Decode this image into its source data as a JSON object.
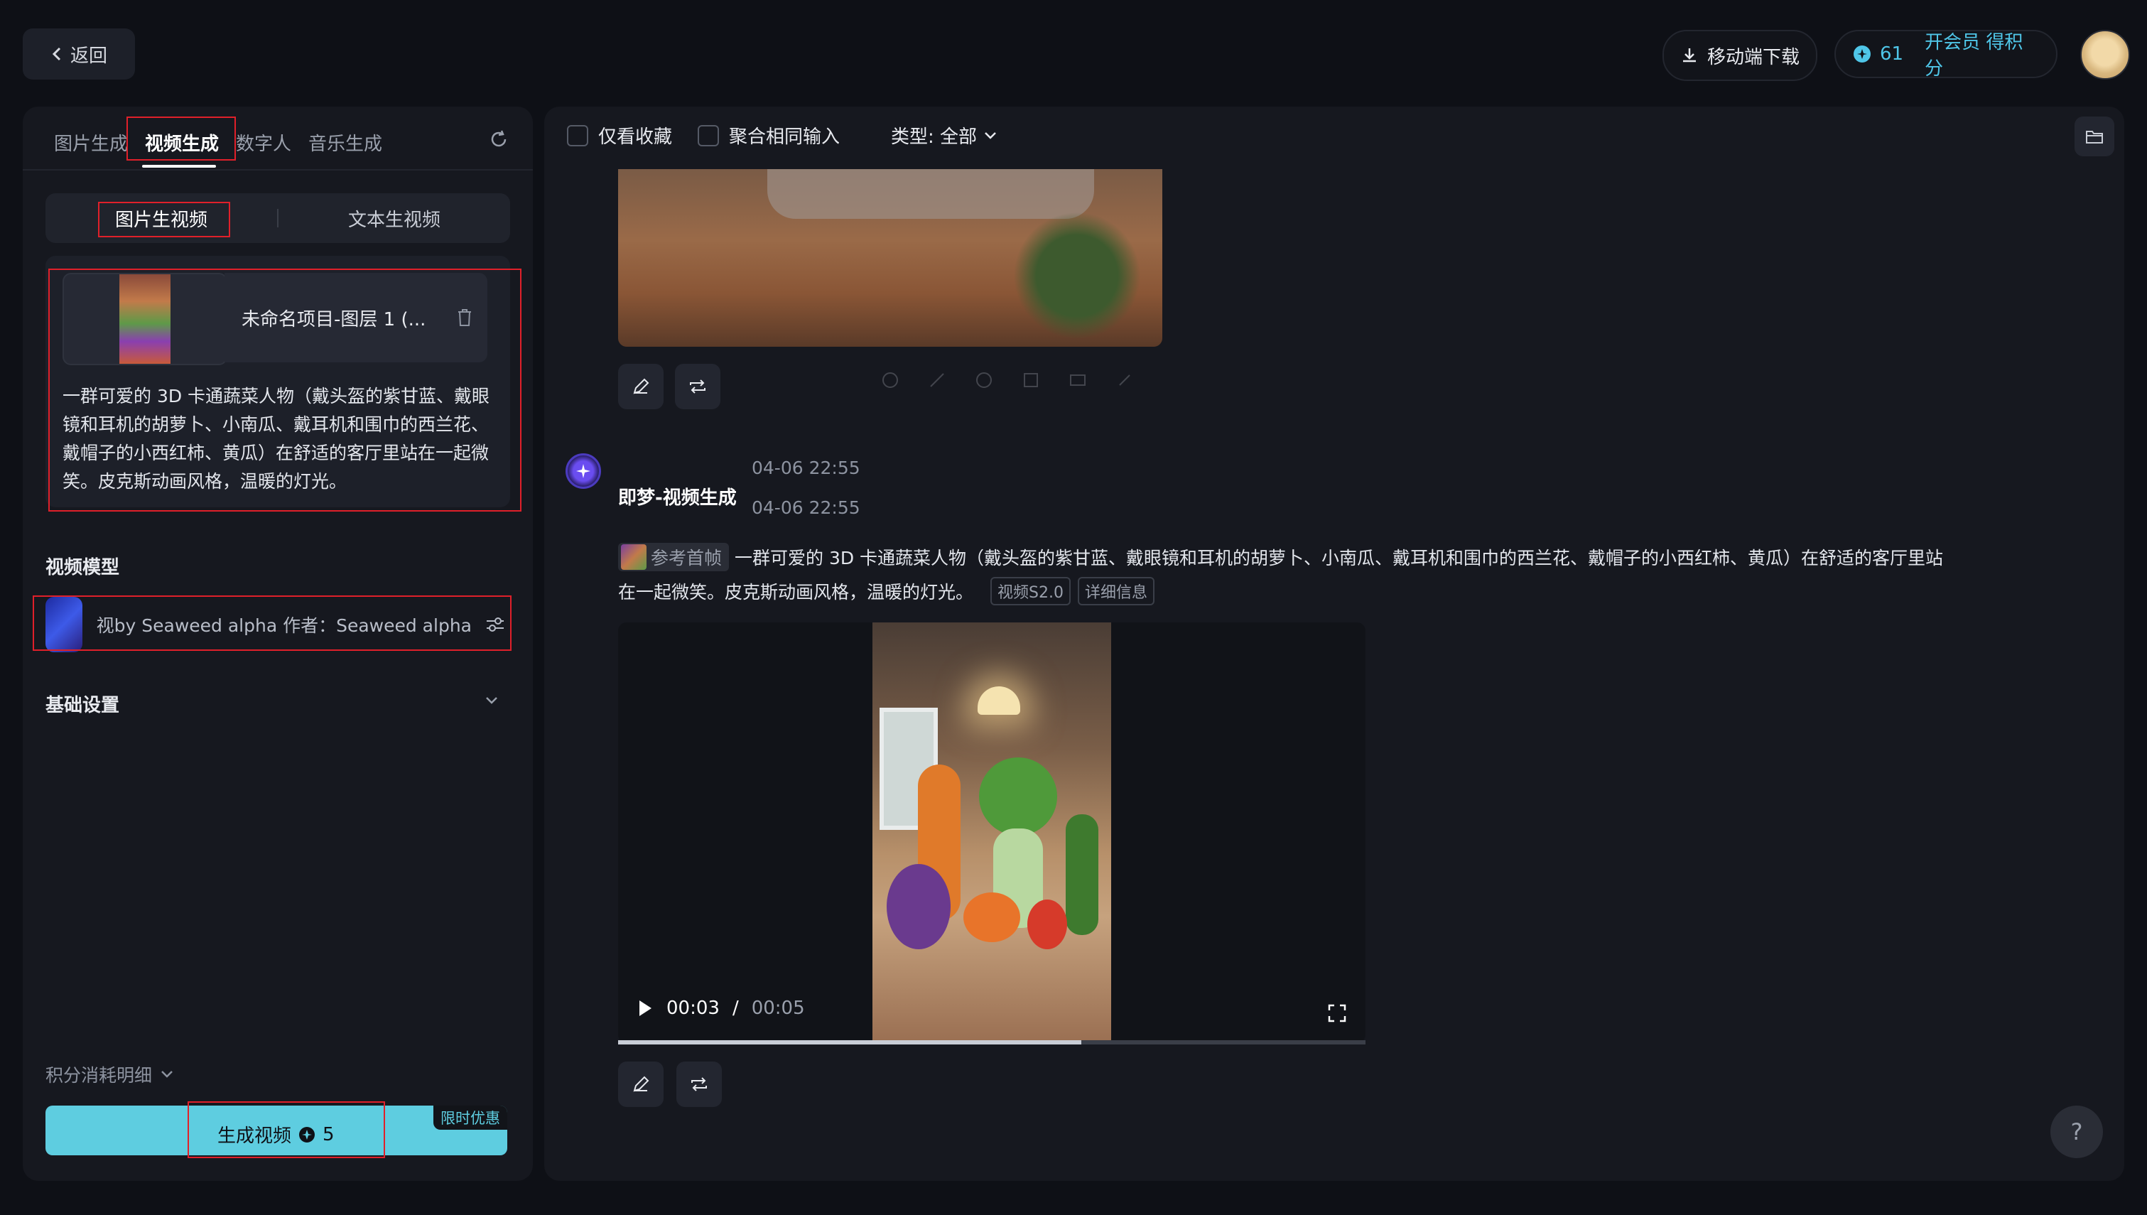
{
  "header": {
    "back_label": "返回",
    "download_label": "移动端下载",
    "credits": "61",
    "vip_label": "开会员 得积分"
  },
  "left": {
    "tabs": [
      {
        "label": "图片生成"
      },
      {
        "label": "视频生成"
      },
      {
        "label": "数字人"
      },
      {
        "label": "音乐生成"
      }
    ],
    "segments": [
      {
        "label": "图片生视频"
      },
      {
        "label": "文本生视频"
      }
    ],
    "image_name": "未命名项目-图层 1 (...",
    "prompt": "一群可爱的 3D 卡通蔬菜人物（戴头盔的紫甘蓝、戴眼镜和耳机的胡萝卜、小南瓜、戴耳机和围巾的西兰花、戴帽子的小西红柿、黄瓜）在舒适的客厅里站在一起微笑。皮克斯动画风格，温暖的灯光。",
    "model_section_title": "视频模型",
    "model_text": "视by Seaweed alpha  作者：Seaweed alpha",
    "basic_settings": "基础设置",
    "credit_detail": "积分消耗明细",
    "generate_label": "生成视频",
    "generate_cost": "5",
    "promo_badge": "限时优惠"
  },
  "right": {
    "filters": {
      "favorites_only": "仅看收藏",
      "merge_same_input": "聚合相同输入",
      "type_label": "类型: 全部"
    },
    "message": {
      "bot_name": "即梦-视频生成",
      "timestamp_1": "04-06  22:55",
      "timestamp_2": "04-06   22:55",
      "ref_label": "参考首帧",
      "prompt_line_1": "一群可爱的 3D 卡通蔬菜人物（戴头盔的紫甘蓝、戴眼镜和耳机的胡萝卜、小南瓜、戴耳机和围巾的西兰花、戴帽子的小西红柿、黄瓜）在舒适的客厅里站",
      "prompt_line_2": "在一起微笑。皮克斯动画风格，温暖的灯光。",
      "tag_model": "视频S2.0",
      "tag_details": "详细信息"
    },
    "video": {
      "current_time": "00:03",
      "separator": "/",
      "duration": "00:05",
      "progress_fraction": 0.62
    },
    "help_label": "?"
  },
  "colors": {
    "accent": "#4fc6e8",
    "generate_button": "#5ecde0",
    "highlight_box": "#e0202a",
    "background": "#0e1016",
    "panel": "#16181f"
  }
}
